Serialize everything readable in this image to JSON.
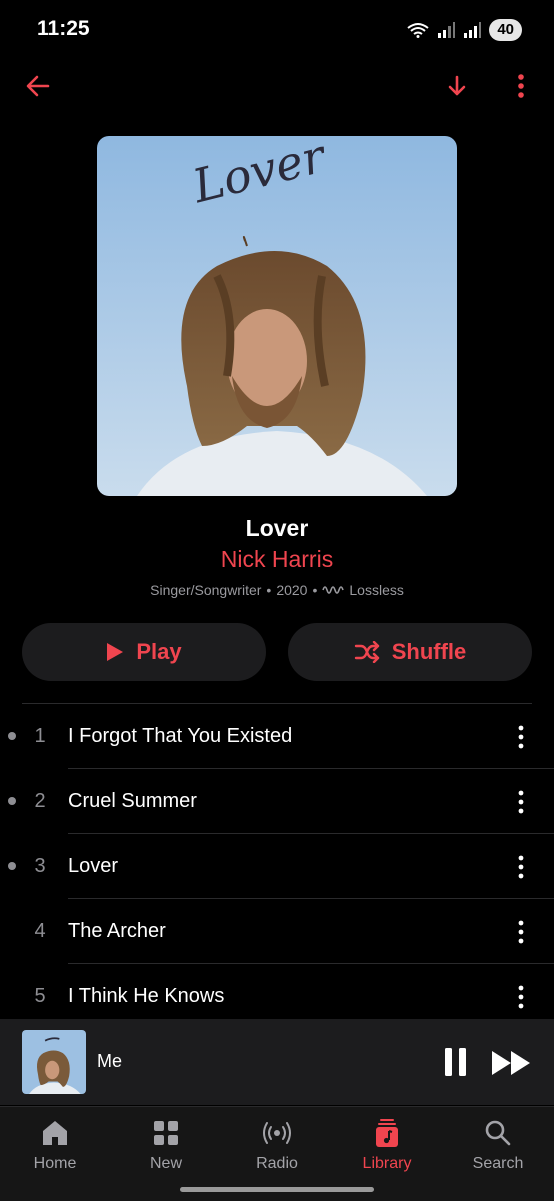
{
  "status_bar": {
    "time": "11:25",
    "battery": "40",
    "icons": [
      "wifi-icon",
      "signal-icon",
      "signal-icon"
    ]
  },
  "top_nav": {
    "back_icon": "arrow-left-icon",
    "download_icon": "arrow-down-icon",
    "more_icon": "more-vertical-icon"
  },
  "album": {
    "artwork_text": "Lover",
    "title": "Lover",
    "artist": "Nick Harris",
    "genre": "Singer/Songwriter",
    "year": "2020",
    "sep": "•",
    "quality": "Lossless"
  },
  "buttons": {
    "play": "Play",
    "shuffle": "Shuffle"
  },
  "tracks": [
    {
      "number": "1",
      "title": "I Forgot That You Existed",
      "played": true
    },
    {
      "number": "2",
      "title": "Cruel Summer",
      "played": true
    },
    {
      "number": "3",
      "title": "Lover",
      "played": true
    },
    {
      "number": "4",
      "title": "The Archer",
      "played": false
    },
    {
      "number": "5",
      "title": "I Think He Knows",
      "played": false
    }
  ],
  "mini_player": {
    "title": "Me",
    "state": "playing"
  },
  "tab_bar": {
    "items": [
      {
        "label": "Home",
        "icon": "home-icon",
        "active": false
      },
      {
        "label": "New",
        "icon": "grid-icon",
        "active": false
      },
      {
        "label": "Radio",
        "icon": "radio-icon",
        "active": false
      },
      {
        "label": "Library",
        "icon": "library-icon",
        "active": true
      },
      {
        "label": "Search",
        "icon": "search-icon",
        "active": false
      }
    ]
  },
  "colors": {
    "accent": "#f0454f",
    "background": "#000000",
    "surface": "#1c1c1e",
    "secondary_text": "#8e8e93"
  }
}
